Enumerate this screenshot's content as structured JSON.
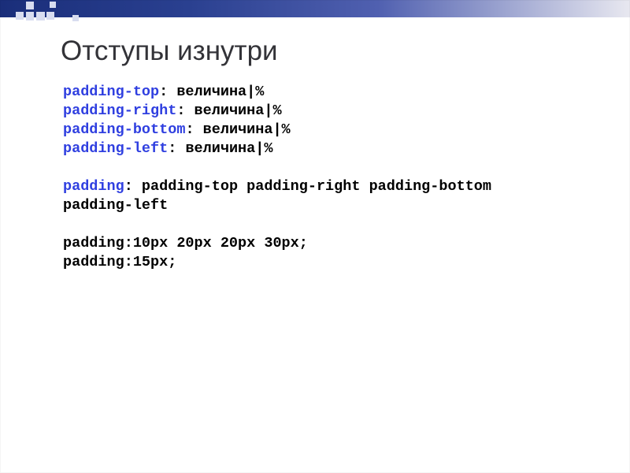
{
  "title": "Отступы изнутри",
  "lines": {
    "l1_kw": "padding-top",
    "l1_rest": ": величина|%",
    "l2_kw": "padding-right",
    "l2_rest": ": величина|%",
    "l3_kw": "padding-bottom",
    "l3_rest": ": величина|%",
    "l4_kw": "padding-left",
    "l4_rest": ": величина|%",
    "l5_kw": "padding",
    "l5_rest": ": padding-top padding-right padding-bottom",
    "l6": "padding-left",
    "l7": "padding:10px 20px 20px 30px;",
    "l8": "padding:15px;"
  }
}
